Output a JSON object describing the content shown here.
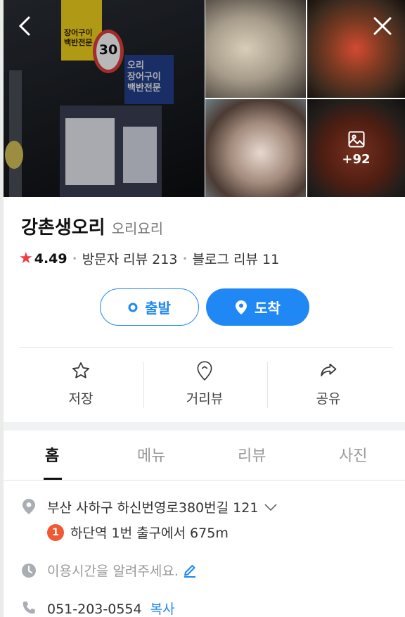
{
  "photos": {
    "count_label": "+92",
    "storefront_signs": {
      "yellow": "장어구이\n백반전문",
      "speed": "30",
      "blue": "오리\n장어구이\n백반전문"
    }
  },
  "place": {
    "name": "강촌생오리",
    "category": "오리요리",
    "rating": "4.49",
    "visitor_reviews": "방문자 리뷰 213",
    "blog_reviews": "블로그 리뷰 11"
  },
  "route": {
    "depart_label": "출발",
    "arrive_label": "도착"
  },
  "actions": {
    "save_label": "저장",
    "streetview_label": "거리뷰",
    "share_label": "공유"
  },
  "tabs": [
    {
      "label": "홈",
      "active": true
    },
    {
      "label": "메뉴",
      "active": false
    },
    {
      "label": "리뷰",
      "active": false
    },
    {
      "label": "사진",
      "active": false
    }
  ],
  "info": {
    "address": "부산 사하구 하신번영로380번길 121",
    "station_number": "1",
    "station_text": "하단역 1번 출구에서 675m",
    "hours_placeholder": "이용시간을 알려주세요.",
    "phone": "051-203-0554",
    "copy_label": "복사"
  },
  "colors": {
    "accent": "#1f88f5",
    "star": "#ef3c42",
    "station_badge": "#ef5a32"
  },
  "icons": [
    "back-arrow-icon",
    "close-icon",
    "gallery-icon",
    "star-icon",
    "location-pin-icon",
    "bookmark-star-icon",
    "streetview-pin-icon",
    "share-icon",
    "chevron-down-icon",
    "clock-icon",
    "edit-pencil-icon",
    "phone-icon"
  ]
}
